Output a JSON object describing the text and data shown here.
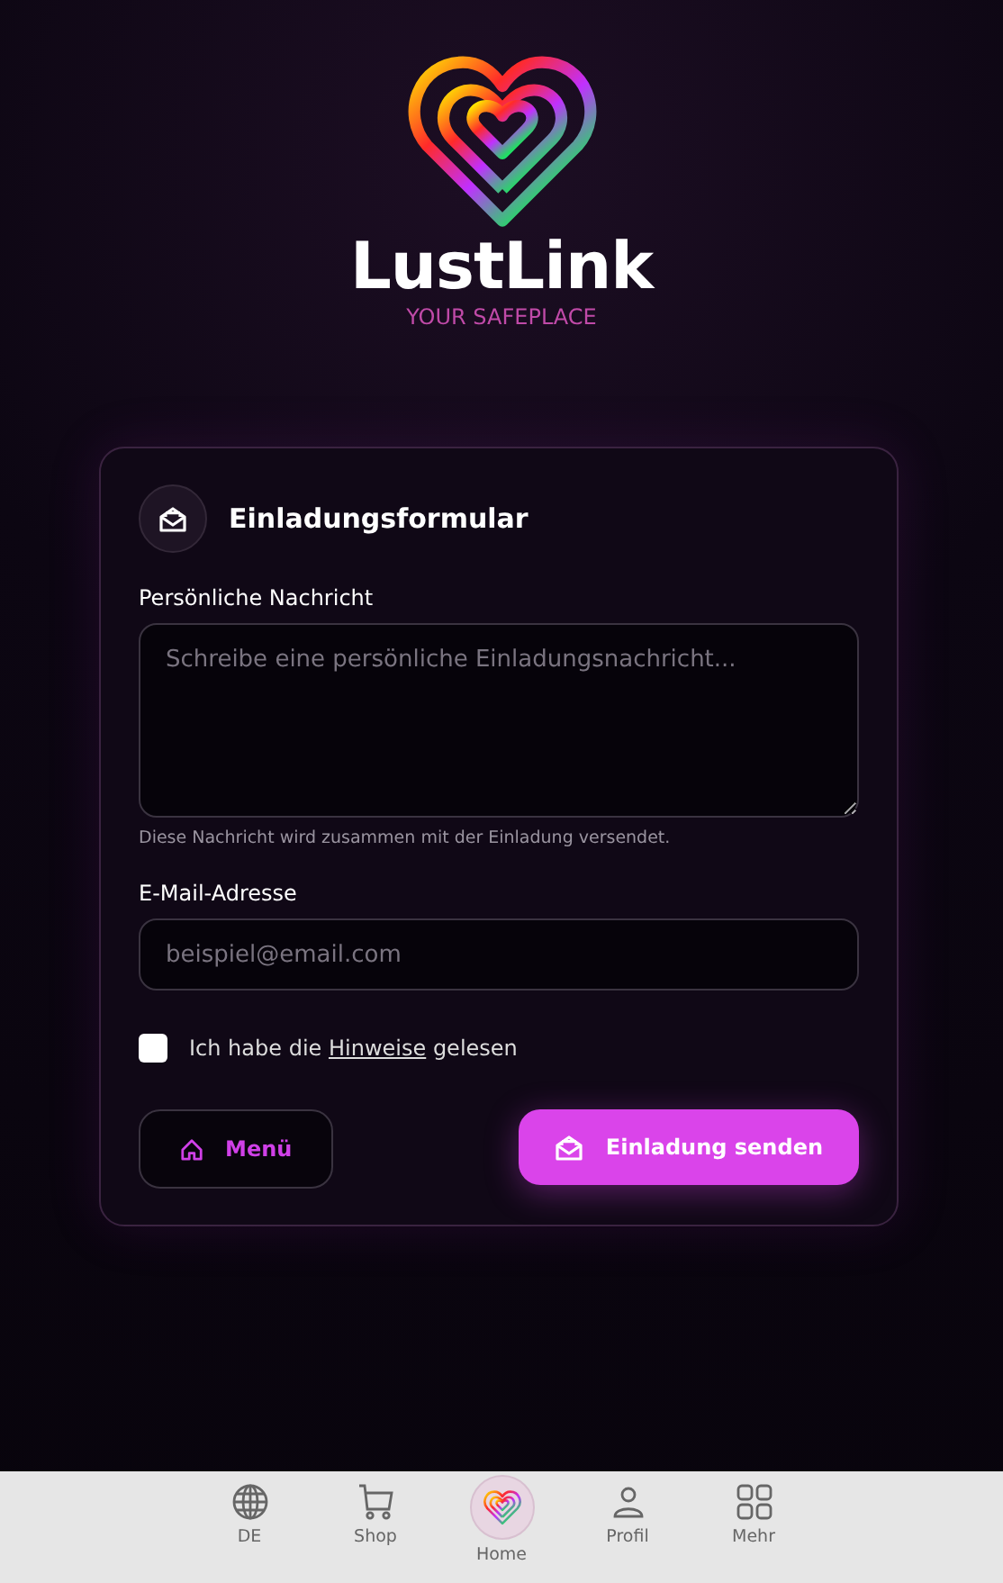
{
  "brand": {
    "name": "LustLink",
    "tagline": "YOUR SAFEPLACE"
  },
  "form": {
    "title": "Einladungsformular",
    "message": {
      "label": "Persönliche Nachricht",
      "placeholder": "Schreibe eine persönliche Einladungsnachricht...",
      "hint": "Diese Nachricht wird zusammen mit der Einladung versendet."
    },
    "email": {
      "label": "E-Mail-Adresse",
      "placeholder": "beispiel@email.com"
    },
    "consent": {
      "before": "Ich habe die",
      "link": "Hinweise",
      "after": "gelesen",
      "checked": false
    },
    "buttons": [
      {
        "kind": "secondary",
        "label": "Menü"
      },
      {
        "kind": "primary",
        "label": "Einladung senden"
      }
    ]
  },
  "nav": [
    {
      "kind": "globe",
      "label": "DE",
      "selected": false
    },
    {
      "kind": "cart",
      "label": "Shop",
      "selected": false
    },
    {
      "kind": "heart",
      "label": "Home",
      "selected": true
    },
    {
      "kind": "person",
      "label": "Profil",
      "selected": false
    },
    {
      "kind": "grid",
      "label": "Mehr",
      "selected": false
    }
  ]
}
